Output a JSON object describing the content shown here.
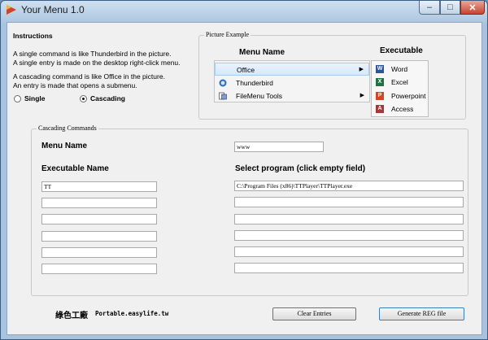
{
  "window": {
    "title": "Your Menu 1.0"
  },
  "instructions": {
    "heading": "Instructions",
    "line1": "A single command is like Thunderbird in the picture.",
    "line2": "A single entry is made on the desktop right-click menu.",
    "line3": "A cascading command is like Office in the picture.",
    "line4": "An entry is made that opens a submenu.",
    "radio_single": "Single",
    "radio_cascading": "Cascading",
    "selected": "Cascading"
  },
  "picture_example": {
    "group_title": "Picture Example",
    "menu_name_header": "Menu Name",
    "executable_header": "Executable",
    "menu_items": [
      {
        "label": "Office",
        "icon": "office-icon",
        "submenu": true
      },
      {
        "label": "Thunderbird",
        "icon": "thunderbird-icon",
        "submenu": false
      },
      {
        "label": "FileMenu Tools",
        "icon": "filemenu-icon",
        "submenu": true
      }
    ],
    "submenu_items": [
      {
        "label": "Word",
        "icon": "word-icon",
        "color": "#2b579a",
        "glyph": "W"
      },
      {
        "label": "Excel",
        "icon": "excel-icon",
        "color": "#217346",
        "glyph": "X"
      },
      {
        "label": "Powerpoint",
        "icon": "powerpoint-icon",
        "color": "#d24726",
        "glyph": "P"
      },
      {
        "label": "Access",
        "icon": "access-icon",
        "color": "#a4373a",
        "glyph": "A"
      }
    ]
  },
  "cascading": {
    "group_title": "Cascading Commands",
    "menu_name_label": "Menu Name",
    "menu_name_value": "www",
    "executable_name_label": "Executable Name",
    "select_program_label": "Select program (click empty field)",
    "rows": [
      {
        "name": "TT",
        "program": "C:\\Program Files (x86)\\TTPlayer\\TTPlayer.exe"
      },
      {
        "name": "",
        "program": ""
      },
      {
        "name": "",
        "program": ""
      },
      {
        "name": "",
        "program": ""
      },
      {
        "name": "",
        "program": ""
      },
      {
        "name": "",
        "program": ""
      }
    ]
  },
  "buttons": {
    "clear": "Clear Entries",
    "generate": "Generate REG file"
  },
  "watermark": {
    "text": "Portable.easylife.tw",
    "glyphs": "綠色工廠"
  }
}
